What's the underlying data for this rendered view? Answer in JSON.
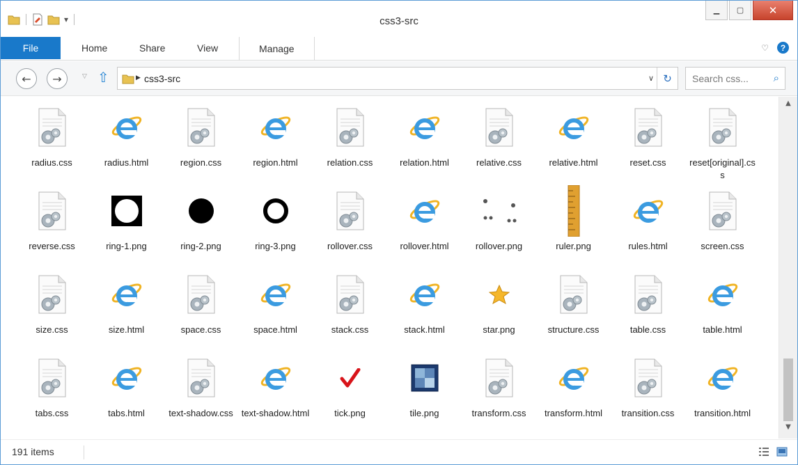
{
  "window": {
    "title": "css3-src"
  },
  "ribbon": {
    "tabs": [
      "File",
      "Home",
      "Share",
      "View",
      "Manage"
    ]
  },
  "address": {
    "path": "css3-src",
    "search_placeholder": "Search css..."
  },
  "status": {
    "item_count": "191 items"
  },
  "files": [
    {
      "name": "radius.css",
      "icon": "css-file-icon"
    },
    {
      "name": "radius.html",
      "icon": "ie-html-icon"
    },
    {
      "name": "region.css",
      "icon": "css-file-icon"
    },
    {
      "name": "region.html",
      "icon": "ie-html-icon"
    },
    {
      "name": "relation.css",
      "icon": "css-file-icon"
    },
    {
      "name": "relation.html",
      "icon": "ie-html-icon"
    },
    {
      "name": "relative.css",
      "icon": "css-file-icon"
    },
    {
      "name": "relative.html",
      "icon": "ie-html-icon"
    },
    {
      "name": "reset.css",
      "icon": "css-file-icon"
    },
    {
      "name": "reset[original].css",
      "icon": "css-file-icon"
    },
    {
      "name": "reverse.css",
      "icon": "css-file-icon"
    },
    {
      "name": "ring-1.png",
      "icon": "ring1-image-icon"
    },
    {
      "name": "ring-2.png",
      "icon": "ring2-image-icon"
    },
    {
      "name": "ring-3.png",
      "icon": "ring3-image-icon"
    },
    {
      "name": "rollover.css",
      "icon": "css-file-icon"
    },
    {
      "name": "rollover.html",
      "icon": "ie-html-icon"
    },
    {
      "name": "rollover.png",
      "icon": "rollover-image-icon"
    },
    {
      "name": "ruler.png",
      "icon": "ruler-image-icon"
    },
    {
      "name": "rules.html",
      "icon": "ie-html-icon"
    },
    {
      "name": "screen.css",
      "icon": "css-file-icon"
    },
    {
      "name": "size.css",
      "icon": "css-file-icon"
    },
    {
      "name": "size.html",
      "icon": "ie-html-icon"
    },
    {
      "name": "space.css",
      "icon": "css-file-icon"
    },
    {
      "name": "space.html",
      "icon": "ie-html-icon"
    },
    {
      "name": "stack.css",
      "icon": "css-file-icon"
    },
    {
      "name": "stack.html",
      "icon": "ie-html-icon"
    },
    {
      "name": "star.png",
      "icon": "star-image-icon"
    },
    {
      "name": "structure.css",
      "icon": "css-file-icon"
    },
    {
      "name": "table.css",
      "icon": "css-file-icon"
    },
    {
      "name": "table.html",
      "icon": "ie-html-icon"
    },
    {
      "name": "tabs.css",
      "icon": "css-file-icon"
    },
    {
      "name": "tabs.html",
      "icon": "ie-html-icon"
    },
    {
      "name": "text-shadow.css",
      "icon": "css-file-icon"
    },
    {
      "name": "text-shadow.html",
      "icon": "ie-html-icon"
    },
    {
      "name": "tick.png",
      "icon": "tick-image-icon"
    },
    {
      "name": "tile.png",
      "icon": "tile-image-icon"
    },
    {
      "name": "transform.css",
      "icon": "css-file-icon"
    },
    {
      "name": "transform.html",
      "icon": "ie-html-icon"
    },
    {
      "name": "transition.css",
      "icon": "css-file-icon"
    },
    {
      "name": "transition.html",
      "icon": "ie-html-icon"
    }
  ]
}
